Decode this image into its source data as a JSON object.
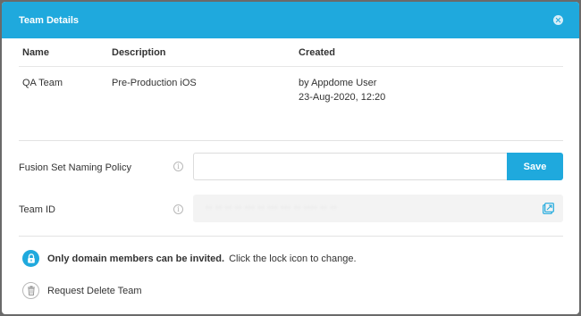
{
  "dialog": {
    "title": "Team Details",
    "close_icon": "close-icon"
  },
  "table": {
    "headers": [
      "Name",
      "Description",
      "Created"
    ],
    "row": {
      "name": "QA Team",
      "description": "Pre-Production iOS",
      "created_by": "by Appdome User",
      "created_at": "23-Aug-2020, 12:20"
    }
  },
  "naming_policy": {
    "label": "Fusion Set Naming Policy",
    "value": "",
    "placeholder": "",
    "save_label": "Save",
    "info_icon": "info-icon"
  },
  "team_id": {
    "label": "Team ID",
    "value": "·· ·· ·· ·· ··· ·· ··· ··· ·· ···· ·· ··",
    "copy_icon": "copy-icon"
  },
  "notice": {
    "strong_text": "Only domain members can be invited.",
    "text": "Click the lock icon to change.",
    "lock_icon": "lock-icon"
  },
  "delete": {
    "label": "Request Delete Team",
    "icon": "trash-icon"
  },
  "colors": {
    "accent": "#1fa9dd",
    "backdrop": "#6a6a6a"
  }
}
